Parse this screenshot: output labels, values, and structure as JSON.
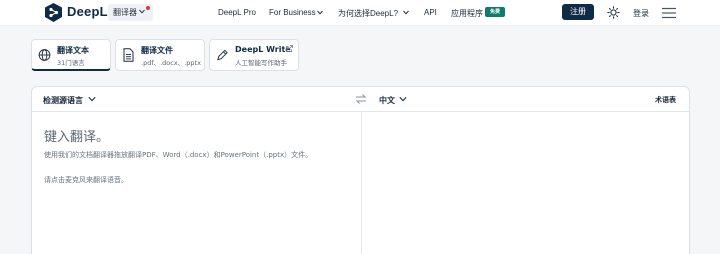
{
  "header": {
    "logo_text": "DeepL",
    "translator_label": "翻译器",
    "nav": {
      "pro": "DeepL Pro",
      "business": "For Business",
      "why": "为何选择DeepL?",
      "api": "API",
      "apps": "应用程序",
      "free_badge": "免费"
    },
    "signup": "注册",
    "login": "登录"
  },
  "tabs": [
    {
      "title": "翻译文本",
      "subtitle": "31门语言",
      "icon": "globe-icon"
    },
    {
      "title": "翻译文件",
      "subtitle": ".pdf、.docx、.pptx",
      "icon": "document-icon"
    },
    {
      "title": "DeepL Write",
      "subtitle": "人工智能写作助手",
      "icon": "pen-icon"
    }
  ],
  "translator": {
    "source_lang": "检测源语言",
    "target_lang": "中文",
    "glossary": "术语表",
    "input_placeholder": "键入翻译。",
    "hint_line1": "使用我们的文档翻译器拖放翻译PDF、Word（.docx）和PowerPoint（.pptx）文件。",
    "hint_line2": "请点击麦克风来翻译语音。"
  },
  "colors": {
    "brand_navy": "#0f2b46",
    "free_badge": "#0f7b6c",
    "notification_dot": "#e5332a"
  }
}
